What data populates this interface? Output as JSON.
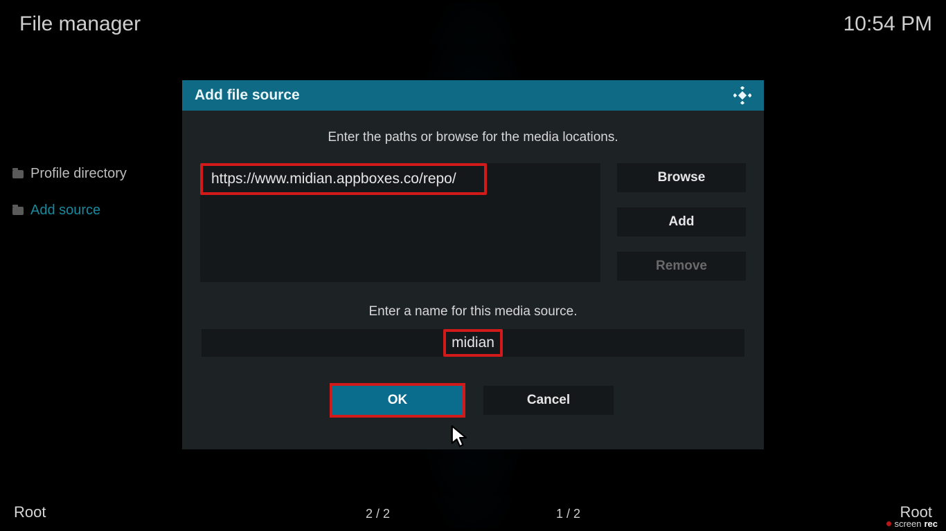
{
  "header": {
    "title": "File manager",
    "clock": "10:54 PM"
  },
  "sidebar": {
    "items": [
      {
        "label": "Profile directory",
        "active": false
      },
      {
        "label": "Add source",
        "active": true
      }
    ]
  },
  "dialog": {
    "title": "Add file source",
    "instruction": "Enter the paths or browse for the media locations.",
    "path_value": "https://www.midian.appboxes.co/repo/",
    "browse_label": "Browse",
    "add_label": "Add",
    "remove_label": "Remove",
    "name_label": "Enter a name for this media source.",
    "name_value": "midian",
    "ok_label": "OK",
    "cancel_label": "Cancel"
  },
  "footer": {
    "left_root": "Root",
    "left_pager": "2 / 2",
    "right_pager": "1 / 2",
    "right_root": "Root"
  },
  "recorder": {
    "brand_1": "screen",
    "brand_2": "rec"
  }
}
